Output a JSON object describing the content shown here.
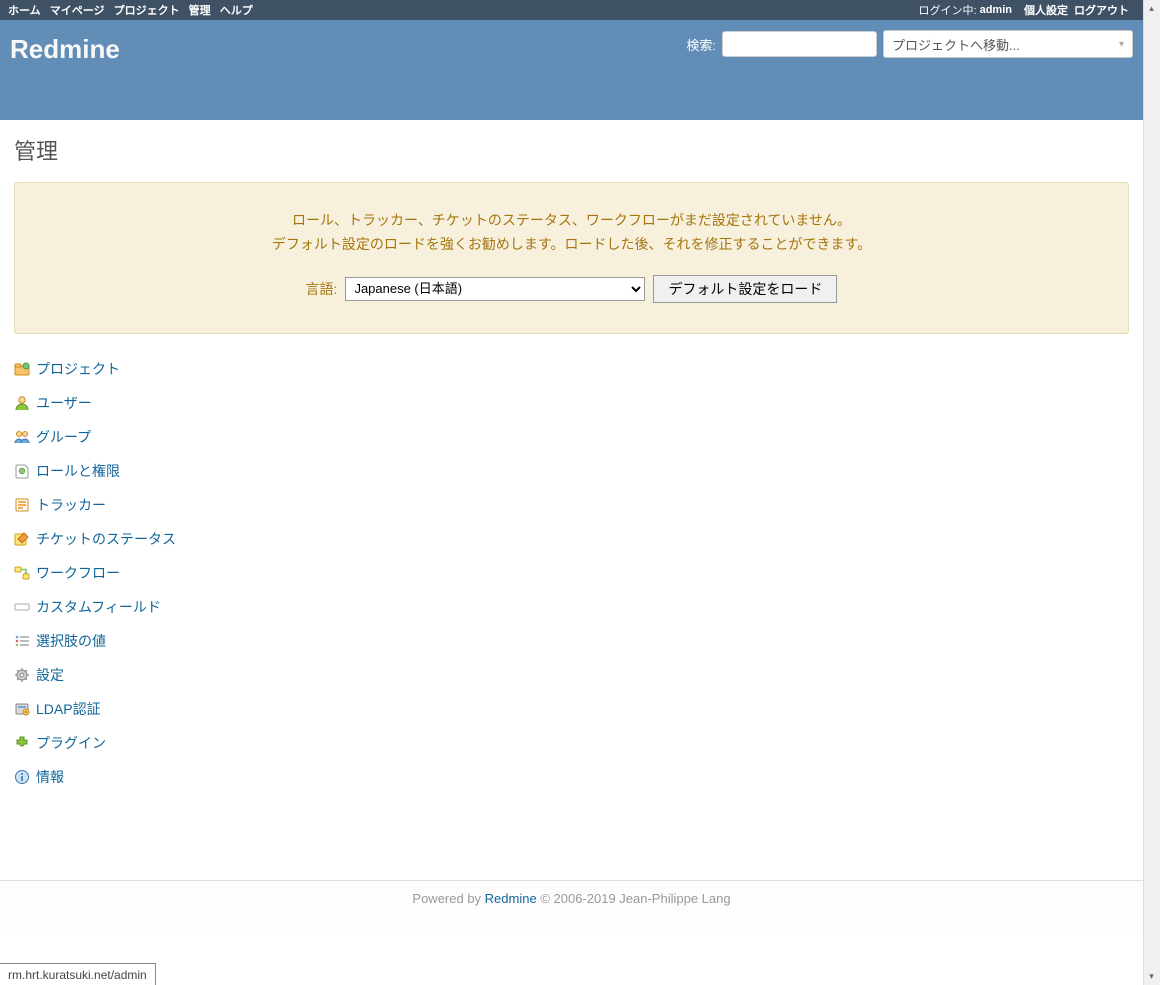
{
  "top_menu": {
    "left": [
      "ホーム",
      "マイページ",
      "プロジェクト",
      "管理",
      "ヘルプ"
    ],
    "logged_as_label": "ログイン中:",
    "logged_as_user": "admin",
    "right": [
      "個人設定",
      "ログアウト"
    ]
  },
  "header": {
    "app_title": "Redmine",
    "search_label": "検索:",
    "project_jump_placeholder": "プロジェクトへ移動..."
  },
  "page": {
    "title": "管理"
  },
  "nodata": {
    "line1": "ロール、トラッカー、チケットのステータス、ワークフローがまだ設定されていません。",
    "line2": "デフォルト設定のロードを強くお勧めします。ロードした後、それを修正することができます。",
    "lang_label": "言語:",
    "lang_selected": "Japanese (日本語)",
    "load_button": "デフォルト設定をロード"
  },
  "admin_menu": [
    {
      "key": "projects",
      "label": "プロジェクト"
    },
    {
      "key": "users",
      "label": "ユーザー"
    },
    {
      "key": "groups",
      "label": "グループ"
    },
    {
      "key": "roles",
      "label": "ロールと権限"
    },
    {
      "key": "trackers",
      "label": "トラッカー"
    },
    {
      "key": "issue_statuses",
      "label": "チケットのステータス"
    },
    {
      "key": "workflows",
      "label": "ワークフロー"
    },
    {
      "key": "custom_fields",
      "label": "カスタムフィールド"
    },
    {
      "key": "enumerations",
      "label": "選択肢の値"
    },
    {
      "key": "settings",
      "label": "設定"
    },
    {
      "key": "ldap",
      "label": "LDAP認証"
    },
    {
      "key": "plugins",
      "label": "プラグイン"
    },
    {
      "key": "info",
      "label": "情報"
    }
  ],
  "footer": {
    "powered_by": "Powered by ",
    "app": "Redmine",
    "copyright": " © 2006-2019 Jean-Philippe Lang"
  },
  "status_bar": {
    "text": "rm.hrt.kuratsuki.net/admin"
  }
}
